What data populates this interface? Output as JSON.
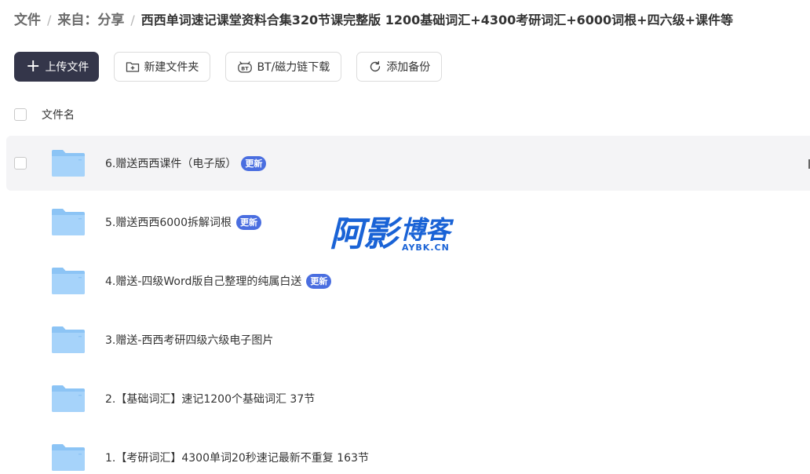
{
  "breadcrumb": {
    "root": "文件",
    "parent": "来自：分享",
    "current": "西西单词速记课堂资料合集320节课完整版 1200基础词汇+4300考研词汇+6000词根+四六级+课件等"
  },
  "toolbar": {
    "upload_label": "上传文件",
    "new_folder_label": "新建文件夹",
    "bt_label": "BT/磁力链下载",
    "backup_label": "添加备份"
  },
  "list": {
    "header_label": "文件名",
    "items": [
      {
        "name": "6.赠送西西课件（电子版）",
        "badge": "更新"
      },
      {
        "name": "5.赠送西西6000拆解词根",
        "badge": "更新"
      },
      {
        "name": "4.赠送-四级Word版自己整理的纯属白送",
        "badge": "更新"
      },
      {
        "name": "3.赠送-西西考研四级六级电子图片",
        "badge": ""
      },
      {
        "name": "2.【基础词汇】速记1200个基础词汇 37节",
        "badge": ""
      },
      {
        "name": "1.【考研词汇】4300单词20秒速记最新不重复 163节",
        "badge": ""
      }
    ]
  },
  "watermark": {
    "chars_big": "阿影",
    "chars_mid": "博客",
    "domain": "AYBK.CN"
  },
  "colors": {
    "primary_button": "#34364a",
    "badge": "#4a6ee0",
    "folder": "#8cc4f5",
    "watermark": "#1a63d6"
  }
}
